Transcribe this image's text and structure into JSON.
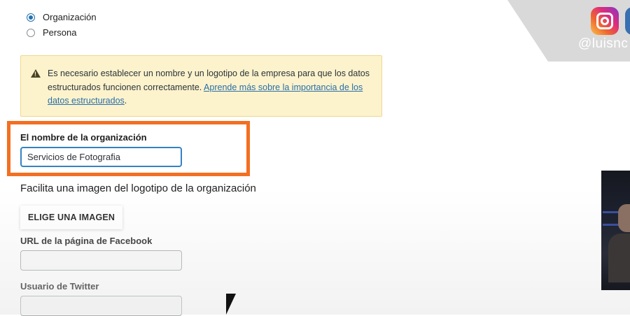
{
  "entity_type": {
    "options": [
      {
        "label": "Organización",
        "checked": true
      },
      {
        "label": "Persona",
        "checked": false
      }
    ]
  },
  "notice": {
    "text": "Es necesario establecer un nombre y un logotipo de la empresa para que los datos estructurados funcionen correctamente. ",
    "link": "Aprende más sobre la importancia de los datos estructurados",
    "suffix": "."
  },
  "org_name": {
    "label": "El nombre de la organización",
    "value": "Servicios de Fotografia"
  },
  "logo": {
    "label": "Facilita una imagen del logotipo de la organización",
    "button": "ELIGE UNA IMAGEN"
  },
  "facebook": {
    "label": "URL de la página de Facebook",
    "value": ""
  },
  "twitter": {
    "label": "Usuario de Twitter",
    "value": ""
  },
  "overlay": {
    "handle": "@luisnc"
  },
  "colors": {
    "accent": "#2271b1",
    "highlight": "#f36f21",
    "notice_bg": "#fcf3cd",
    "link": "#2a6ea6"
  }
}
